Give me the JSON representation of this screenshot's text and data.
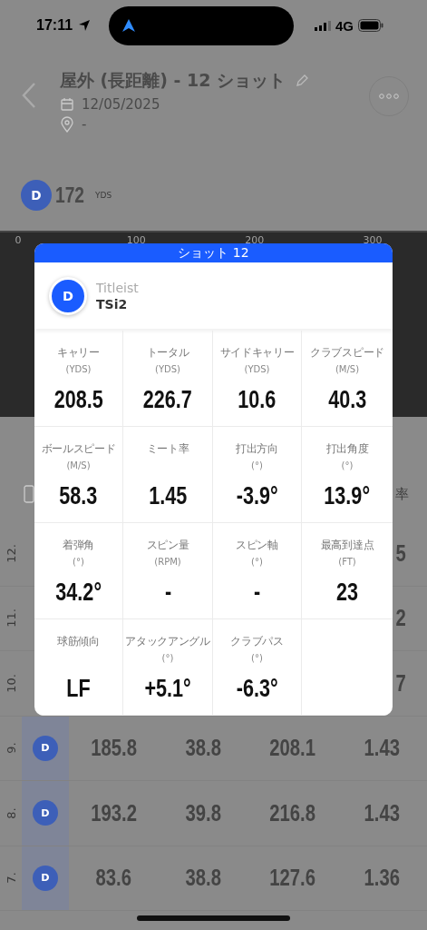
{
  "status_bar": {
    "time": "17:11",
    "network": "4G"
  },
  "header": {
    "title": "屋外 (長距離) - 12 ショット",
    "date": "12/05/2025",
    "location": "-"
  },
  "summary": {
    "club_letter": "D",
    "distance": "172",
    "unit": "YDS"
  },
  "chart_axis": [
    "0",
    "100",
    "200",
    "300"
  ],
  "table": {
    "header_fragment": "率",
    "rows": [
      {
        "number": "12.",
        "edge_fragment": "5"
      },
      {
        "number": "11.",
        "edge_fragment": "2"
      },
      {
        "number": "10.",
        "edge_fragment": "7"
      },
      {
        "number": "9.",
        "club_letter": "D",
        "values": [
          "185.8",
          "38.8",
          "208.1",
          "1.43"
        ]
      },
      {
        "number": "8.",
        "club_letter": "D",
        "values": [
          "193.2",
          "39.8",
          "216.8",
          "1.43"
        ]
      },
      {
        "number": "7.",
        "club_letter": "D",
        "values": [
          "83.6",
          "38.8",
          "127.6",
          "1.36"
        ]
      }
    ]
  },
  "dialog": {
    "title": "ショット 12",
    "club_letter": "D",
    "brand": "Titleist",
    "model": "TSi2",
    "metrics": [
      {
        "label": "キャリー",
        "unit": "(YDS)",
        "value": "208.5"
      },
      {
        "label": "トータル",
        "unit": "(YDS)",
        "value": "226.7"
      },
      {
        "label": "サイドキャリー",
        "unit": "(YDS)",
        "value": "10.6"
      },
      {
        "label": "クラブスピード",
        "unit": "(M/S)",
        "value": "40.3"
      },
      {
        "label": "ボールスピード",
        "unit": "(M/S)",
        "value": "58.3"
      },
      {
        "label": "ミート率",
        "value": "1.45"
      },
      {
        "label": "打出方向",
        "unit": "(°)",
        "value": "-3.9°"
      },
      {
        "label": "打出角度",
        "unit": "(°)",
        "value": "13.9°"
      },
      {
        "label": "着弾角",
        "unit": "(°)",
        "value": "34.2°"
      },
      {
        "label": "スピン量",
        "unit": "(RPM)",
        "value": "-"
      },
      {
        "label": "スピン軸",
        "unit": "(°)",
        "value": "-"
      },
      {
        "label": "最高到達点",
        "unit": "(FT)",
        "value": "23"
      },
      {
        "label": "球筋傾向",
        "value": "LF"
      },
      {
        "label": "アタックアングル",
        "unit": "(°)",
        "value": "+5.1°"
      },
      {
        "label": "クラブパス",
        "unit": "(°)",
        "value": "-6.3°"
      }
    ]
  }
}
